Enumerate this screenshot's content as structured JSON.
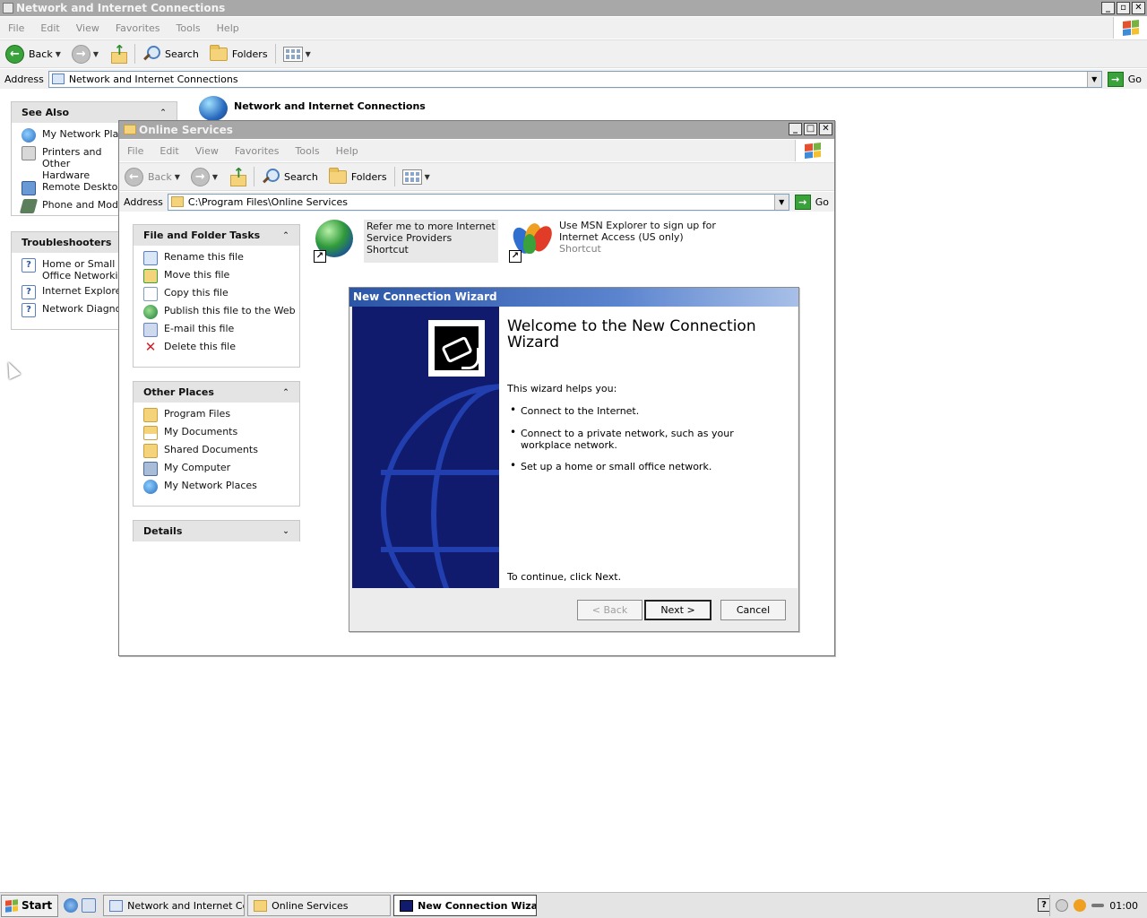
{
  "main_window": {
    "title": "Network and Internet Connections",
    "menu": [
      "File",
      "Edit",
      "View",
      "Favorites",
      "Tools",
      "Help"
    ],
    "toolbar": {
      "back": "Back",
      "search": "Search",
      "folders": "Folders"
    },
    "address_label": "Address",
    "address_value": "Network and Internet Connections",
    "go_label": "Go",
    "header_title": "Network and Internet Connections",
    "see_also": {
      "title": "See Also",
      "items": [
        {
          "label": "My Network Places",
          "icon": "network-places-icon"
        },
        {
          "label": "Printers and Other Hardware",
          "icon": "printer-icon"
        },
        {
          "label": "Remote Desktop",
          "icon": "remote-desktop-icon"
        },
        {
          "label": "Phone and Modem Options",
          "icon": "phone-icon"
        }
      ]
    },
    "troubleshooters": {
      "title": "Troubleshooters",
      "items": [
        {
          "label": "Home or Small Office Networking",
          "icon": "help-icon"
        },
        {
          "label": "Internet Explorer",
          "icon": "help-icon"
        },
        {
          "label": "Network Diagnostics",
          "icon": "help-icon"
        }
      ]
    }
  },
  "online_services": {
    "title": "Online Services",
    "menu": [
      "File",
      "Edit",
      "View",
      "Favorites",
      "Tools",
      "Help"
    ],
    "toolbar": {
      "back": "Back",
      "search": "Search",
      "folders": "Folders"
    },
    "address_label": "Address",
    "address_value": "C:\\Program Files\\Online Services",
    "go_label": "Go",
    "file_tasks": {
      "title": "File and Folder Tasks",
      "items": [
        {
          "label": "Rename this file",
          "icon": "rename-icon"
        },
        {
          "label": "Move this file",
          "icon": "move-icon"
        },
        {
          "label": "Copy this file",
          "icon": "copy-icon"
        },
        {
          "label": "Publish this file to the Web",
          "icon": "web-publish-icon"
        },
        {
          "label": "E-mail this file",
          "icon": "email-icon"
        },
        {
          "label": "Delete this file",
          "icon": "delete-icon"
        }
      ]
    },
    "other_places": {
      "title": "Other Places",
      "items": [
        {
          "label": "Program Files",
          "icon": "folder-icon"
        },
        {
          "label": "My Documents",
          "icon": "documents-icon"
        },
        {
          "label": "Shared Documents",
          "icon": "folder-icon"
        },
        {
          "label": "My Computer",
          "icon": "computer-icon"
        },
        {
          "label": "My Network Places",
          "icon": "network-places-icon"
        }
      ]
    },
    "details": {
      "title": "Details"
    },
    "shortcuts": [
      {
        "line1": "Refer me to more Internet",
        "line2": "Service Providers",
        "sub": "Shortcut"
      },
      {
        "line1": "Use MSN Explorer to sign up for",
        "line2": "Internet Access (US only)",
        "sub": "Shortcut"
      }
    ]
  },
  "wizard": {
    "title": "New Connection Wizard",
    "heading": "Welcome to the New Connection Wizard",
    "intro": "This wizard helps you:",
    "bullets": [
      "Connect to the Internet.",
      "Connect to a private network, such as your workplace network.",
      "Set up a home or small office network."
    ],
    "continue_text": "To continue, click Next.",
    "buttons": {
      "back": "< Back",
      "next": "Next >",
      "cancel": "Cancel"
    }
  },
  "taskbar": {
    "start": "Start",
    "tasks": [
      "Network and Internet Co...",
      "Online Services",
      "New Connection Wizard"
    ],
    "clock": "01:00"
  },
  "colors": {
    "wizard_title": "#2b55a6",
    "wizard_side": "#101b6e",
    "go_green": "#3aa23a"
  }
}
